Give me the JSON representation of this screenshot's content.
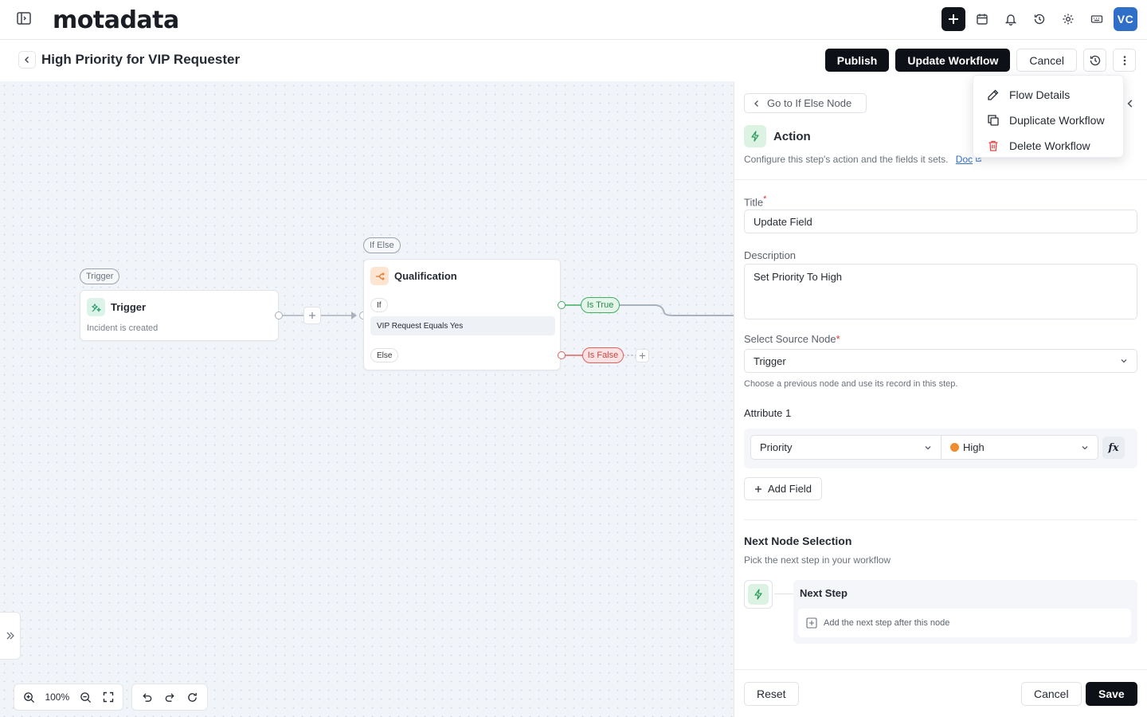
{
  "app": {
    "logo": "motadata",
    "user_initials": "VC"
  },
  "topbar": {
    "icons": [
      "plus-icon",
      "calendar-icon",
      "bell-icon",
      "history-icon",
      "gear-icon",
      "keyboard-icon"
    ]
  },
  "header": {
    "title": "High Priority for VIP Requester",
    "publish_label": "Publish",
    "update_label": "Update Workflow",
    "cancel_label": "Cancel"
  },
  "menu": {
    "items": [
      {
        "label": "Flow Details",
        "icon": "pencil-icon"
      },
      {
        "label": "Duplicate Workflow",
        "icon": "copy-icon"
      },
      {
        "label": "Delete Workflow",
        "icon": "trash-icon"
      }
    ]
  },
  "canvas": {
    "trigger_tag": "Trigger",
    "trigger_title": "Trigger",
    "trigger_sub": "Incident is created",
    "ifelse_tag": "If Else",
    "qual_title": "Qualification",
    "if_label": "If",
    "condition": "VIP Request Equals Yes",
    "else_label": "Else",
    "true_label": "Is True",
    "false_label": "Is False",
    "zoom": "100%"
  },
  "panel": {
    "goto_label": "Go to If Else Node",
    "action_title": "Action",
    "action_desc": "Configure this step's action and the fields it sets.",
    "doc_label": "Doc",
    "title_label": "Title",
    "title_value": "Update Field",
    "desc_label": "Description",
    "desc_value": "Set Priority To High",
    "source_label": "Select Source Node",
    "source_value": "Trigger",
    "source_helper": "Choose a previous node and use its record in this step.",
    "attr_label": "Attribute 1",
    "attr_field": "Priority",
    "attr_value": "High",
    "attr_value_color": "#f08c2e",
    "fx_label": "fx",
    "add_field_label": "Add Field",
    "next_title": "Next Node Selection",
    "next_sub": "Pick the next step in your workflow",
    "next_step_label": "Next Step",
    "next_add_label": "Add the next step after this node",
    "reset_label": "Reset",
    "cancel_label": "Cancel",
    "save_label": "Save"
  }
}
